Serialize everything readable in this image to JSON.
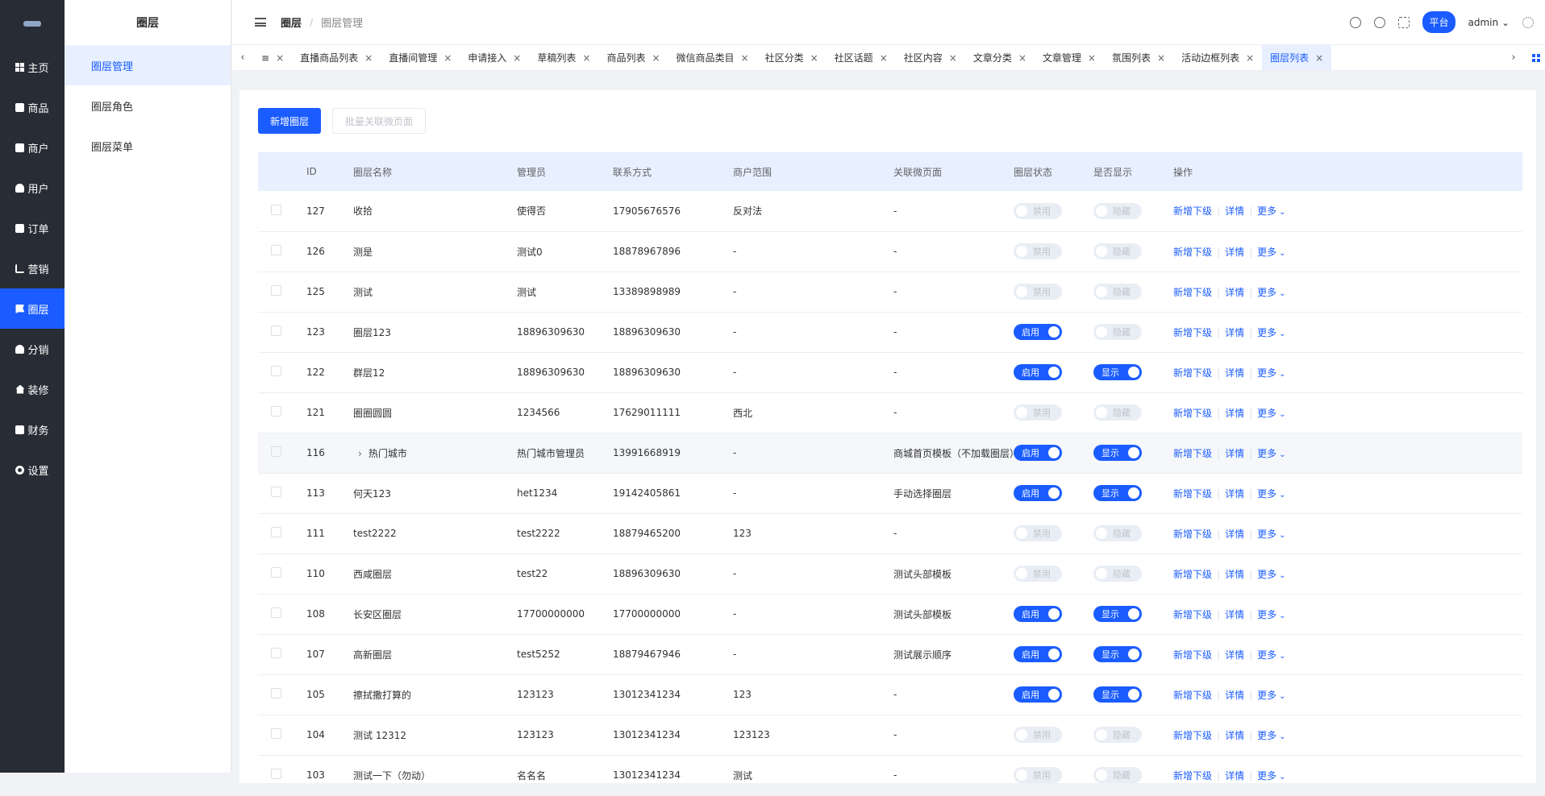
{
  "sidebar": {
    "items": [
      {
        "label": "主页"
      },
      {
        "label": "商品"
      },
      {
        "label": "商户"
      },
      {
        "label": "用户"
      },
      {
        "label": "订单"
      },
      {
        "label": "营销"
      },
      {
        "label": "圈层"
      },
      {
        "label": "分销"
      },
      {
        "label": "装修"
      },
      {
        "label": "财务"
      },
      {
        "label": "设置"
      }
    ],
    "active_index": 6
  },
  "submenu": {
    "title": "圈层",
    "items": [
      {
        "label": "圈层管理"
      },
      {
        "label": "圈层角色"
      },
      {
        "label": "圈层菜单"
      }
    ]
  },
  "header": {
    "breadcrumb_root": "圈层",
    "breadcrumb_separator": "/",
    "breadcrumb_current": "圈层管理",
    "platform_label": "平台",
    "user_label": "admin"
  },
  "tabs": {
    "prev_arrow": "‹",
    "next_arrow": "›",
    "first_partial": "≡",
    "items": [
      {
        "label": "直播商品列表"
      },
      {
        "label": "直播间管理"
      },
      {
        "label": "申请接入"
      },
      {
        "label": "草稿列表"
      },
      {
        "label": "商品列表"
      },
      {
        "label": "微信商品类目"
      },
      {
        "label": "社区分类"
      },
      {
        "label": "社区话题"
      },
      {
        "label": "社区内容"
      },
      {
        "label": "文章分类"
      },
      {
        "label": "文章管理"
      },
      {
        "label": "氛围列表"
      },
      {
        "label": "活动边框列表"
      },
      {
        "label": "圈层列表"
      }
    ]
  },
  "toolbar": {
    "add_label": "新增圈层",
    "batch_label": "批量关联微页面"
  },
  "table": {
    "columns": [
      "ID",
      "圈层名称",
      "管理员",
      "联系方式",
      "商户范围",
      "关联微页面",
      "圈层状态",
      "是否显示",
      "操作"
    ],
    "status_on": "启用",
    "status_off": "禁用",
    "show_on": "显示",
    "show_off": "隐藏",
    "op_add": "新增下级",
    "op_detail": "详情",
    "op_more": "更多",
    "rows": [
      {
        "id": "127",
        "name": "收拾",
        "admin": "使得否",
        "contact": "17905676576",
        "scope": "反对法",
        "page": "-",
        "status": false,
        "show": false
      },
      {
        "id": "126",
        "name": "测是",
        "admin": "测试0",
        "contact": "18878967896",
        "scope": "-",
        "page": "-",
        "status": false,
        "show": false
      },
      {
        "id": "125",
        "name": "测试",
        "admin": "测试",
        "contact": "13389898989",
        "scope": "-",
        "page": "-",
        "status": false,
        "show": false
      },
      {
        "id": "123",
        "name": "圈层123",
        "admin": "18896309630",
        "contact": "18896309630",
        "scope": "-",
        "page": "-",
        "status": true,
        "show": false
      },
      {
        "id": "122",
        "name": "群层12",
        "admin": "18896309630",
        "contact": "18896309630",
        "scope": "-",
        "page": "-",
        "status": true,
        "show": true
      },
      {
        "id": "121",
        "name": "圈圈圆圆",
        "admin": "1234566",
        "contact": "17629011111",
        "scope": "西北",
        "page": "-",
        "status": false,
        "show": false
      },
      {
        "id": "116",
        "name": "热门城市",
        "admin": "热门城市管理员",
        "contact": "13991668919",
        "scope": "-",
        "page": "商城首页模板（不加载圈层）",
        "status": true,
        "show": true,
        "expandable": true,
        "hover": true
      },
      {
        "id": "113",
        "name": "何天123",
        "admin": "het1234",
        "contact": "19142405861",
        "scope": "-",
        "page": "手动选择圈层",
        "status": true,
        "show": true
      },
      {
        "id": "111",
        "name": "test2222",
        "admin": "test2222",
        "contact": "18879465200",
        "scope": "123",
        "page": "-",
        "status": false,
        "show": false
      },
      {
        "id": "110",
        "name": "西咸圈层",
        "admin": "test22",
        "contact": "18896309630",
        "scope": "-",
        "page": "测试头部模板",
        "status": false,
        "show": false
      },
      {
        "id": "108",
        "name": "长安区圈层",
        "admin": "17700000000",
        "contact": "17700000000",
        "scope": "-",
        "page": "测试头部模板",
        "status": true,
        "show": true
      },
      {
        "id": "107",
        "name": "高新圈层",
        "admin": "test5252",
        "contact": "18879467946",
        "scope": "-",
        "page": "测试展示顺序",
        "status": true,
        "show": true
      },
      {
        "id": "105",
        "name": "擦拭撒打算的",
        "admin": "123123",
        "contact": "13012341234",
        "scope": "123",
        "page": "-",
        "status": true,
        "show": true
      },
      {
        "id": "104",
        "name": "测试 12312",
        "admin": "123123",
        "contact": "13012341234",
        "scope": "123123",
        "page": "-",
        "status": false,
        "show": false
      },
      {
        "id": "103",
        "name": "测试一下（勿动）",
        "admin": "名名名",
        "contact": "13012341234",
        "scope": "测试",
        "page": "-",
        "status": false,
        "show": false
      }
    ]
  }
}
